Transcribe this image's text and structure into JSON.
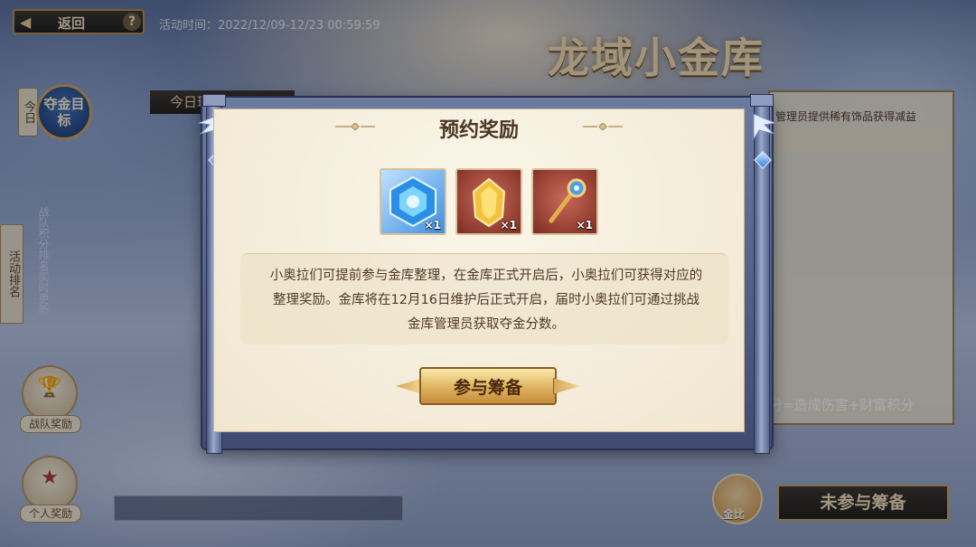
{
  "header": {
    "back_label": "返回",
    "help_glyph": "?",
    "event_time": "活动时间：2022/12/09-12/23 00:59:59",
    "title": "龙域小金库"
  },
  "left": {
    "today_tag": "今日",
    "target_medal": "夺金目标",
    "tab_label": "今日理员",
    "side_rank": "活动排名",
    "side_strip": "战队积分排名实时更新",
    "team_reward": "战队奖励",
    "personal_reward": "个人奖励"
  },
  "right": {
    "desc": "管理员提供稀有饰品获得减益",
    "formula": "积分=造成伤害+财富积分",
    "piggy_label": "金比",
    "not_joined_label": "未参与筹备"
  },
  "modal": {
    "title": "预约奖励",
    "rewards": [
      {
        "name": "blue-crystal",
        "qty": "×1"
      },
      {
        "name": "golden-gem",
        "qty": "×1"
      },
      {
        "name": "golden-staff",
        "qty": "×1"
      }
    ],
    "description_lines": [
      "小奥拉们可提前参与金库整理，在金库正式开启后，小奥拉们可获得对应的",
      "整理奖励。金库将在12月16日维护后正式开启，届时小奥拉们可通过挑战",
      "金库管理员获取夺金分数。"
    ],
    "join_button": "参与筹备"
  },
  "colors": {
    "panel_bg": "#f7f0df",
    "title_text": "#4a3623",
    "gold": "#dcae5a",
    "frame_blue": "#6c7aa2"
  }
}
